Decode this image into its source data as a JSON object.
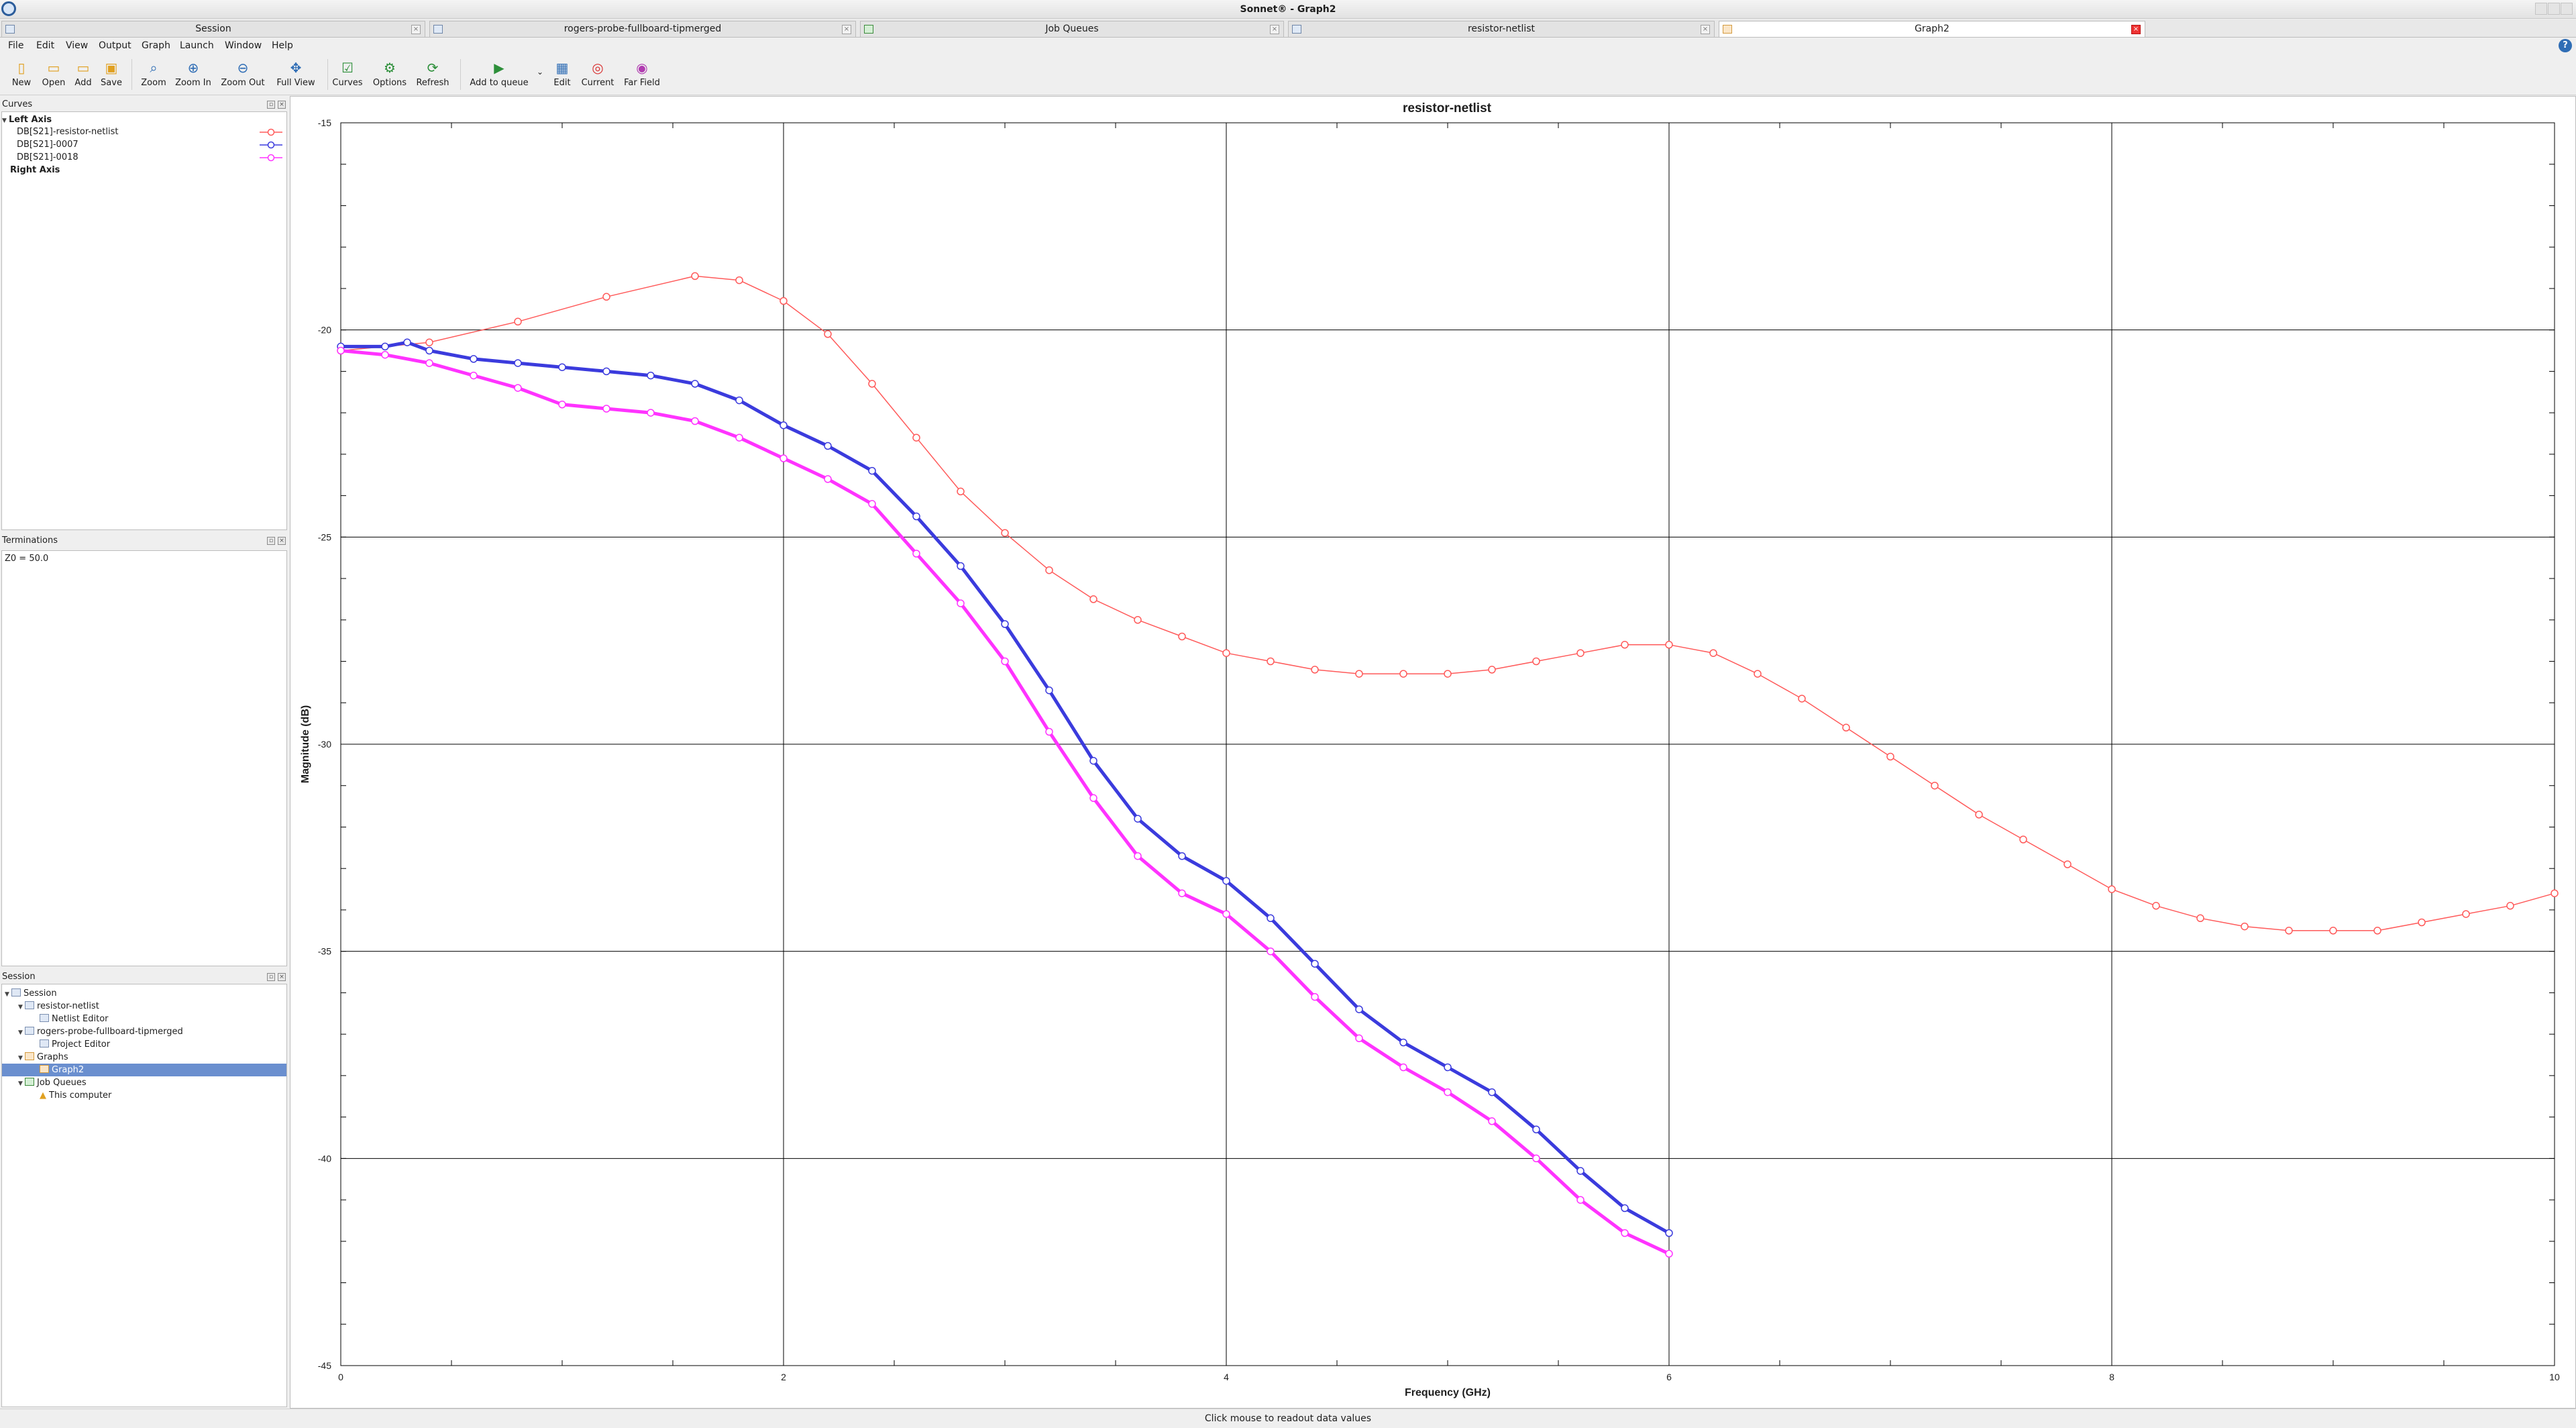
{
  "window": {
    "title": "Sonnet® - Graph2"
  },
  "tabs": [
    {
      "label": "Session",
      "active": false
    },
    {
      "label": "rogers-probe-fullboard-tipmerged",
      "active": false
    },
    {
      "label": "Job Queues",
      "active": false
    },
    {
      "label": "resistor-netlist",
      "active": false
    },
    {
      "label": "Graph2",
      "active": true
    }
  ],
  "menu": [
    "File",
    "Edit",
    "View",
    "Output",
    "Graph",
    "Launch",
    "Window",
    "Help"
  ],
  "toolbar": {
    "new": "New",
    "open": "Open",
    "add": "Add",
    "save": "Save",
    "zoom": "Zoom",
    "zoom_in": "Zoom In",
    "zoom_out": "Zoom Out",
    "full_view": "Full View",
    "curves": "Curves",
    "options": "Options",
    "refresh": "Refresh",
    "add_to_queue": "Add to queue",
    "edit": "Edit",
    "current": "Current",
    "far_field": "Far Field"
  },
  "panels": {
    "curves": {
      "title": "Curves",
      "left_axis": "Left Axis",
      "items": [
        {
          "label": "DB[S21]-resistor-netlist",
          "color": "#ff5a5a"
        },
        {
          "label": "DB[S21]-0007",
          "color": "#3b3bdd"
        },
        {
          "label": "DB[S21]-0018",
          "color": "#ff33ff"
        }
      ],
      "right_axis": "Right Axis"
    },
    "terminations": {
      "title": "Terminations",
      "text": "Z0 = 50.0"
    },
    "session": {
      "title": "Session",
      "tree": [
        {
          "label": "Session"
        },
        {
          "label": "resistor-netlist"
        },
        {
          "label": "Netlist Editor"
        },
        {
          "label": "rogers-probe-fullboard-tipmerged"
        },
        {
          "label": "Project Editor"
        },
        {
          "label": "Graphs"
        },
        {
          "label": "Graph2"
        },
        {
          "label": "Job Queues"
        },
        {
          "label": "This computer"
        }
      ]
    }
  },
  "status_text": "Click mouse to readout data values",
  "chart_data": {
    "type": "line",
    "title": "resistor-netlist",
    "xlabel": "Frequency (GHz)",
    "ylabel": "Magnitude (dB)",
    "xlim": [
      0,
      10
    ],
    "ylim": [
      -45,
      -15
    ],
    "x_ticks": [
      0,
      2,
      4,
      6,
      8,
      10
    ],
    "y_ticks": [
      -15,
      -20,
      -25,
      -30,
      -35,
      -40,
      -45
    ],
    "grid": true,
    "series": [
      {
        "name": "DB[S21]-resistor-netlist",
        "color": "#ff5a5a",
        "marker": "circle-open",
        "x": [
          0,
          0.4,
          0.8,
          1.2,
          1.6,
          1.8,
          2.0,
          2.2,
          2.4,
          2.6,
          2.8,
          3.0,
          3.2,
          3.4,
          3.6,
          3.8,
          4.0,
          4.2,
          4.4,
          4.6,
          4.8,
          5.0,
          5.2,
          5.4,
          5.6,
          5.8,
          6.0,
          6.2,
          6.4,
          6.6,
          6.8,
          7.0,
          7.2,
          7.4,
          7.6,
          7.8,
          8.0,
          8.2,
          8.4,
          8.6,
          8.8,
          9.0,
          9.2,
          9.4,
          9.6,
          9.8,
          10.0
        ],
        "y": [
          -20.5,
          -20.3,
          -19.8,
          -19.2,
          -18.7,
          -18.8,
          -19.3,
          -20.1,
          -21.3,
          -22.6,
          -23.9,
          -24.9,
          -25.8,
          -26.5,
          -27.0,
          -27.4,
          -27.8,
          -28.0,
          -28.2,
          -28.3,
          -28.3,
          -28.3,
          -28.2,
          -28.0,
          -27.8,
          -27.6,
          -27.6,
          -27.8,
          -28.3,
          -28.9,
          -29.6,
          -30.3,
          -31.0,
          -31.7,
          -32.3,
          -32.9,
          -33.5,
          -33.9,
          -34.2,
          -34.4,
          -34.5,
          -34.5,
          -34.5,
          -34.3,
          -34.1,
          -33.9,
          -33.6
        ]
      },
      {
        "name": "DB[S21]-0007",
        "color": "#3b3bdd",
        "marker": "circle-open",
        "x": [
          0,
          0.2,
          0.3,
          0.4,
          0.6,
          0.8,
          1.0,
          1.2,
          1.4,
          1.6,
          1.8,
          2.0,
          2.2,
          2.4,
          2.6,
          2.8,
          3.0,
          3.2,
          3.4,
          3.6,
          3.8,
          4.0,
          4.2,
          4.4,
          4.6,
          4.8,
          5.0,
          5.2,
          5.4,
          5.6,
          5.8,
          6.0
        ],
        "y": [
          -20.4,
          -20.4,
          -20.3,
          -20.5,
          -20.7,
          -20.8,
          -20.9,
          -21.0,
          -21.1,
          -21.3,
          -21.7,
          -22.3,
          -22.8,
          -23.4,
          -24.5,
          -25.7,
          -27.1,
          -28.7,
          -30.4,
          -31.8,
          -32.7,
          -33.3,
          -34.2,
          -35.3,
          -36.4,
          -37.2,
          -37.8,
          -38.4,
          -39.3,
          -40.3,
          -41.2,
          -41.8
        ]
      },
      {
        "name": "DB[S21]-0018",
        "color": "#ff33ff",
        "marker": "circle-open",
        "x": [
          0,
          0.2,
          0.4,
          0.6,
          0.8,
          1.0,
          1.2,
          1.4,
          1.6,
          1.8,
          2.0,
          2.2,
          2.4,
          2.6,
          2.8,
          3.0,
          3.2,
          3.4,
          3.6,
          3.8,
          4.0,
          4.2,
          4.4,
          4.6,
          4.8,
          5.0,
          5.2,
          5.4,
          5.6,
          5.8,
          6.0
        ],
        "y": [
          -20.5,
          -20.6,
          -20.8,
          -21.1,
          -21.4,
          -21.8,
          -21.9,
          -22.0,
          -22.2,
          -22.6,
          -23.1,
          -23.6,
          -24.2,
          -25.4,
          -26.6,
          -28.0,
          -29.7,
          -31.3,
          -32.7,
          -33.6,
          -34.1,
          -35.0,
          -36.1,
          -37.1,
          -37.8,
          -38.4,
          -39.1,
          -40.0,
          -41.0,
          -41.8,
          -42.3
        ]
      }
    ]
  }
}
